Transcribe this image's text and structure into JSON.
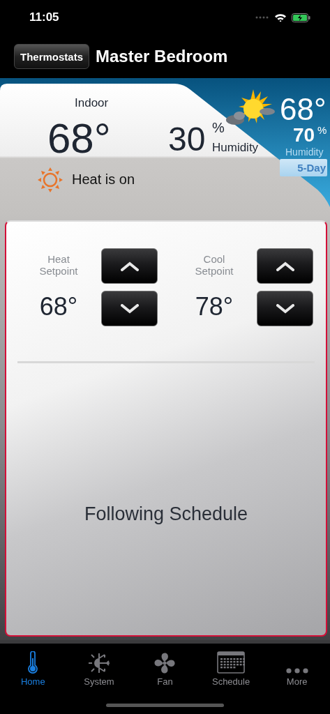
{
  "status_bar": {
    "time": "11:05"
  },
  "nav": {
    "back_button": "Thermostats",
    "title": "Master Bedroom"
  },
  "indoor": {
    "label": "Indoor",
    "temperature": "68°",
    "humidity": "30",
    "humidity_unit": "%",
    "humidity_label": "Humidity",
    "heat_status": "Heat is on"
  },
  "outdoor": {
    "temperature": "68°",
    "humidity": "70",
    "humidity_unit": "%",
    "humidity_label": "Humidity",
    "forecast_button": "5-Day"
  },
  "setpoints": [
    {
      "label": "Heat Setpoint",
      "value": "68°"
    },
    {
      "label": "Cool Setpoint",
      "value": "78°"
    }
  ],
  "mode_status": "Following Schedule",
  "tabs": [
    {
      "label": "Home",
      "kind": "thermometer",
      "selected": true
    },
    {
      "label": "System",
      "kind": "system",
      "selected": false
    },
    {
      "label": "Fan",
      "kind": "fan",
      "selected": false
    },
    {
      "label": "Schedule",
      "kind": "calendar",
      "selected": false
    },
    {
      "label": "More",
      "kind": "more",
      "selected": false
    }
  ]
}
